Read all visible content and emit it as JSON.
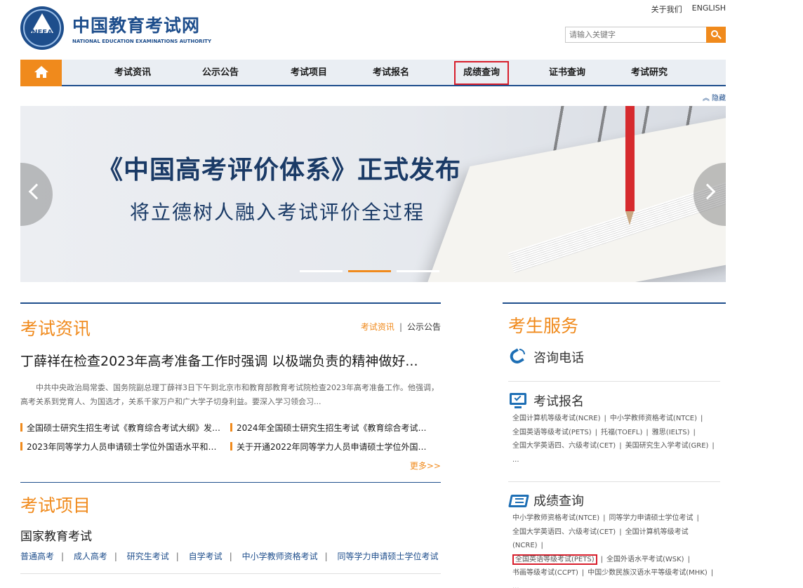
{
  "header": {
    "logo_cn": "中国教育考试网",
    "logo_en": "NATIONAL EDUCATION EXAMINATIONS AUTHORITY",
    "logo_badge": "NEEA",
    "top_links": [
      "关于我们",
      "ENGLISH"
    ],
    "search_placeholder": "请输入关键字"
  },
  "nav": {
    "items": [
      "考试资讯",
      "公示公告",
      "考试项目",
      "考试报名",
      "成绩查询",
      "证书查询",
      "考试研究"
    ],
    "active": "成绩查询"
  },
  "hide_link": "隐藏",
  "banner": {
    "title": "《中国高考评价体系》正式发布",
    "subtitle": "将立德树人融入考试评价全过程",
    "slides": 3,
    "active_slide": 2
  },
  "news": {
    "title": "考试资讯",
    "tabs": [
      "考试资讯",
      "公示公告"
    ],
    "headline": "丁薛祥在检查2023年高考准备工作时强调 以极端负责的精神做好...",
    "summary": "中共中央政治局常委、国务院副总理丁薛祥3日下午到北京市和教育部教育考试院检查2023年高考准备工作。他强调，高考关系到党育人、为国选才，关系千家万户和广大学子切身利益。要深入学习领会习...",
    "items": [
      "全国硕士研究生招生考试《教育综合考试大纲》发布...",
      "2024年全国硕士研究生招生考试《教育综合考试大纲...",
      "2023年同等学力人员申请硕士学位外国语水平和学科...",
      "关于开通2022年同等学力人员申请硕士学位外国语水..."
    ],
    "more": "更多>>"
  },
  "projects": {
    "title": "考试项目",
    "subtitle": "国家教育考试",
    "links": [
      "普通高考",
      "成人高考",
      "研究生考试",
      "自学考试",
      "中小学教师资格考试",
      "同等学力申请硕士学位考试"
    ]
  },
  "services": {
    "title": "考生服务",
    "phone": {
      "title": "咨询电话"
    },
    "registration": {
      "title": "考试报名",
      "links": [
        "全国计算机等级考试(NCRE)",
        "中小学教师资格考试(NTCE)",
        "全国英语等级考试(PETS)",
        "托福(TOEFL)",
        "雅思(IELTS)",
        "全国大学英语四、六级考试(CET)",
        "美国研究生入学考试(GRE)"
      ],
      "ellipsis": "..."
    },
    "scores": {
      "title": "成绩查询",
      "links": [
        "中小学教师资格考试(NTCE)",
        "同等学力申请硕士学位考试",
        "全国大学英语四、六级考试(CET)",
        "全国计算机等级考试(NCRE)",
        "全国英语等级考试(PETS)",
        "全国外语水平考试(WSK)",
        "书画等级考试(CCPT)",
        "中国少数民族汉语水平等级考试(MHK)"
      ],
      "highlighted": "全国英语等级考试(PETS)",
      "ellipsis": "..."
    }
  },
  "colors": {
    "brand_blue": "#1e4e8c",
    "accent_orange": "#f08a1c",
    "highlight_red": "#d81e2b"
  }
}
